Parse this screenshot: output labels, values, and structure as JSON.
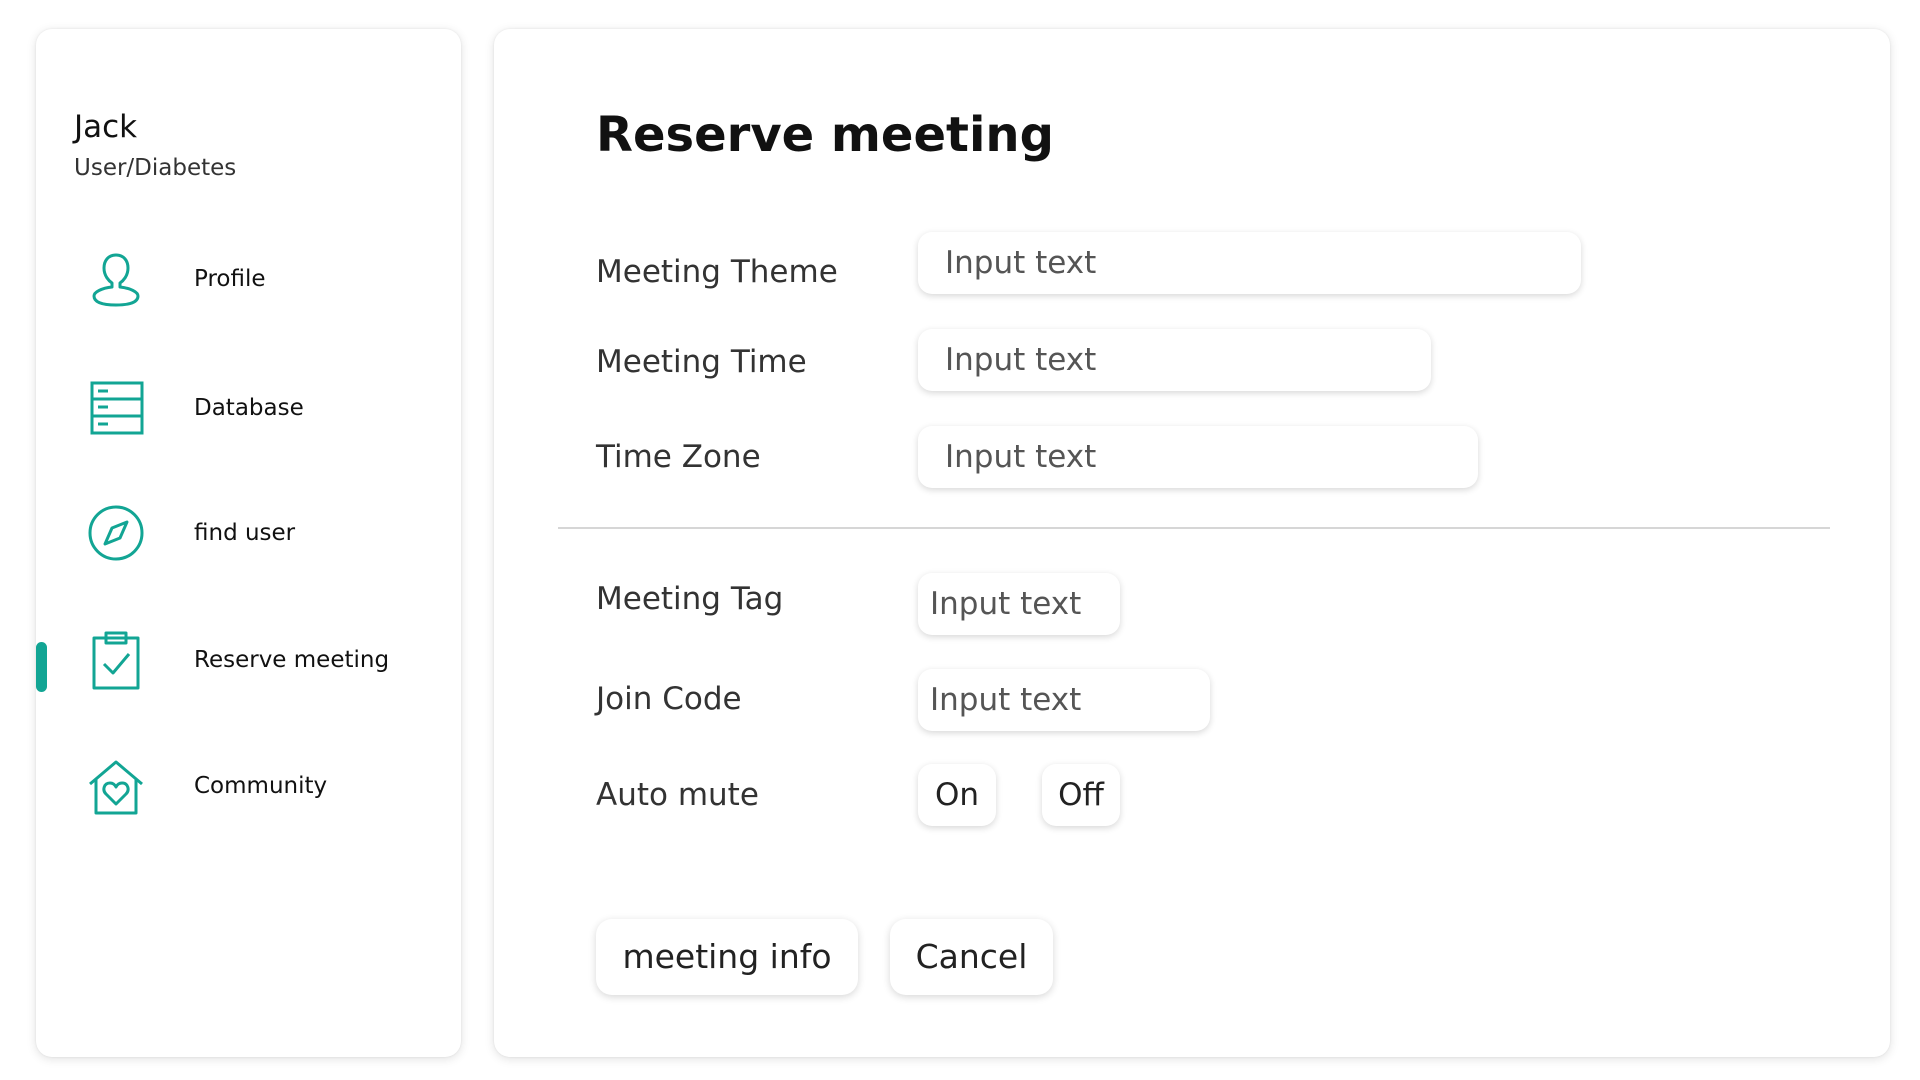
{
  "user": {
    "name": "Jack",
    "role": "User/Diabetes"
  },
  "accent_color": "#12a594",
  "nav": {
    "items": [
      {
        "label": "Profile",
        "icon": "user-icon",
        "active": false
      },
      {
        "label": "Database",
        "icon": "database-icon",
        "active": false
      },
      {
        "label": "find user",
        "icon": "compass-icon",
        "active": false
      },
      {
        "label": "Reserve meeting",
        "icon": "clipboard-check-icon",
        "active": true
      },
      {
        "label": "Community",
        "icon": "home-heart-icon",
        "active": false
      }
    ]
  },
  "form": {
    "title": "Reserve meeting",
    "fields": {
      "meeting_theme": {
        "label": "Meeting Theme",
        "placeholder": "Input text"
      },
      "meeting_time": {
        "label": "Meeting Time",
        "placeholder": "Input text"
      },
      "time_zone": {
        "label": "Time Zone",
        "placeholder": "Input text"
      },
      "meeting_tag": {
        "label": "Meeting Tag",
        "placeholder": "Input text"
      },
      "join_code": {
        "label": "Join Code",
        "placeholder": "Input text"
      }
    },
    "auto_mute": {
      "label": "Auto mute",
      "on_label": "On",
      "off_label": "Off"
    },
    "buttons": {
      "info_label": "meeting info",
      "cancel_label": "Cancel"
    }
  }
}
